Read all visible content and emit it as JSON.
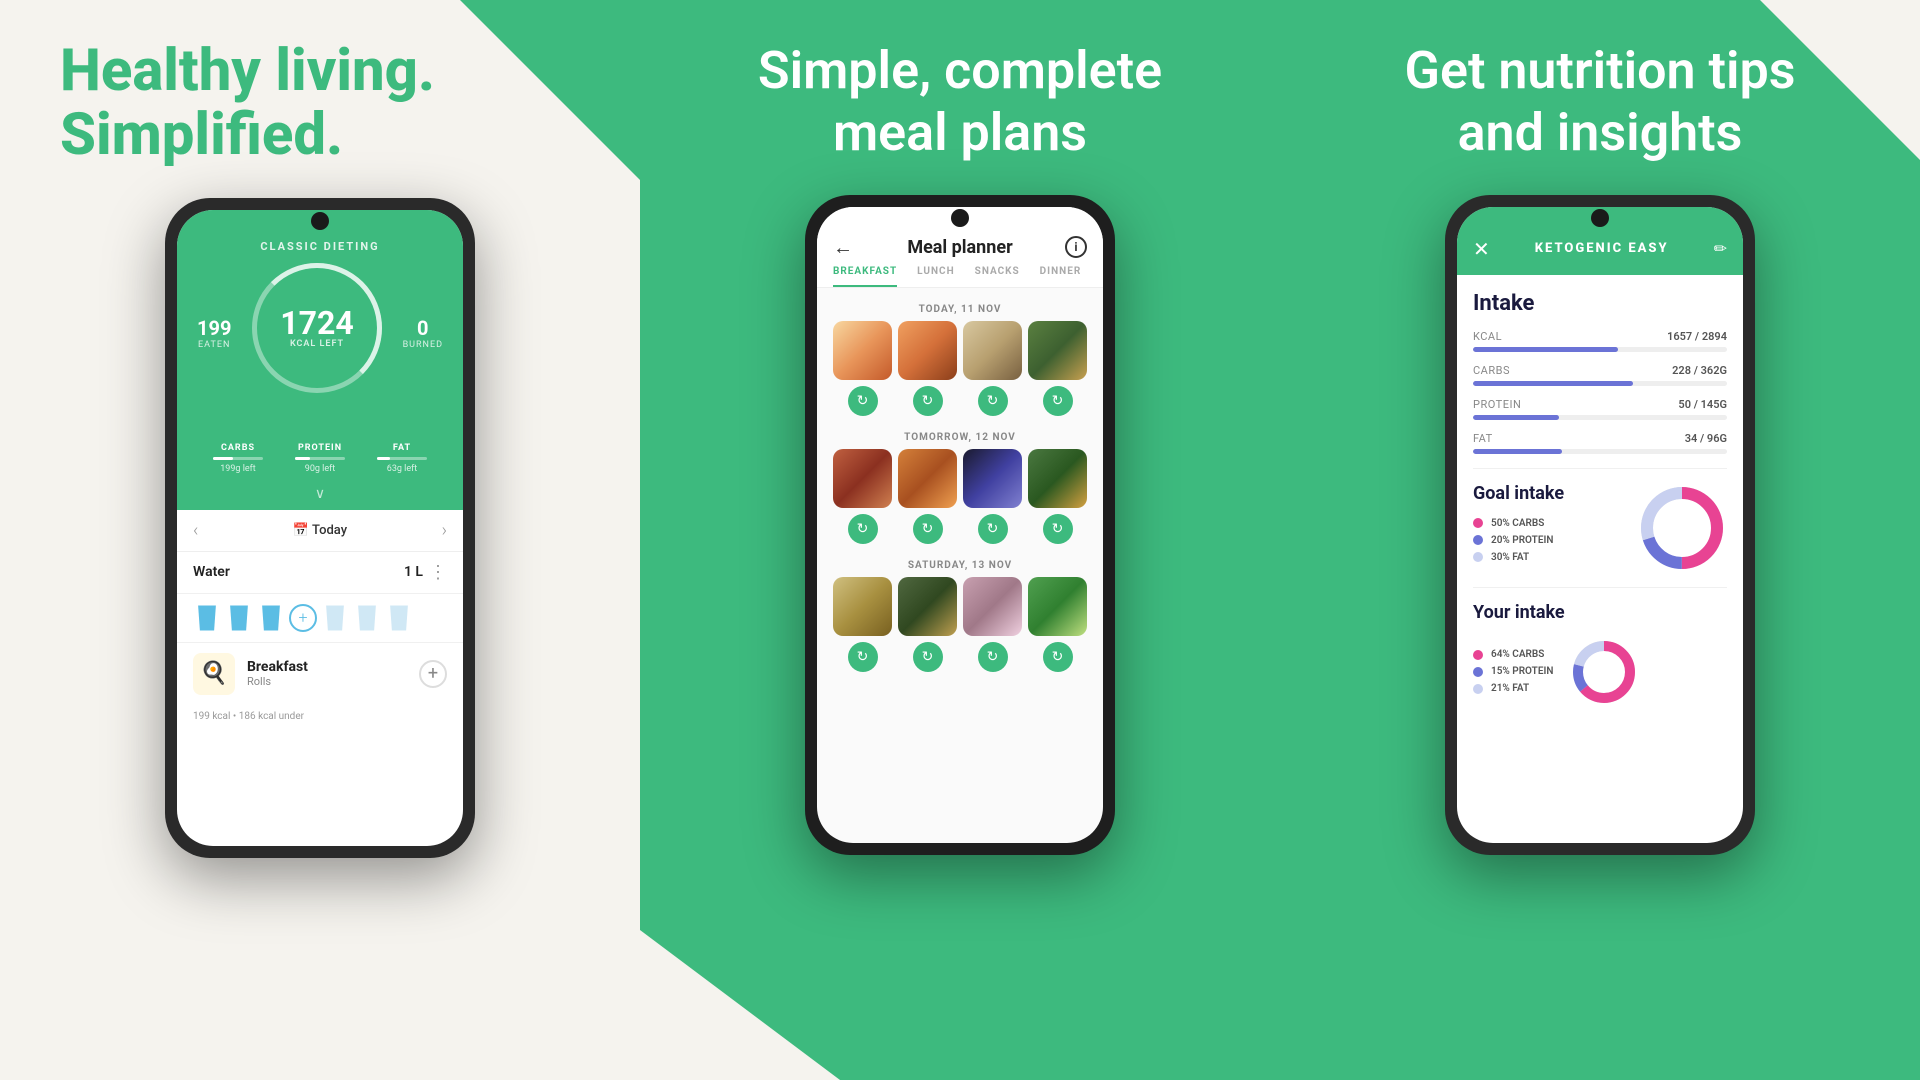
{
  "panel1": {
    "heading_line1": "Healthy living.",
    "heading_line2": "Simplified.",
    "phone": {
      "diet_label": "CLASSIC DIETING",
      "eaten": "199",
      "eaten_label": "EATEN",
      "kcal_left": "1724",
      "kcal_left_label": "KCAL LEFT",
      "burned": "0",
      "burned_label": "BURNED",
      "macros": [
        {
          "name": "CARBS",
          "left": "199g left",
          "fill": 40
        },
        {
          "name": "PROTEIN",
          "left": "90g left",
          "fill": 30
        },
        {
          "name": "FAT",
          "left": "63g left",
          "fill": 25
        }
      ],
      "nav_date": "Today",
      "water_title": "Water",
      "water_amount": "1 L",
      "meal_name": "Breakfast",
      "meal_sub": "Rolls",
      "meal_kcal": "199 kcal • 186 kcal under"
    }
  },
  "panel2": {
    "heading": "Simple, complete meal plans",
    "phone": {
      "title": "Meal planner",
      "tabs": [
        "BREAKFAST",
        "LUNCH",
        "SNACKS",
        "DINNER"
      ],
      "active_tab": "BREAKFAST",
      "days": [
        {
          "label": "TODAY, 11 NOV",
          "meals": [
            "food-1",
            "food-2",
            "food-3",
            "food-4"
          ]
        },
        {
          "label": "TOMORROW, 12 NOV",
          "meals": [
            "food-5",
            "food-6",
            "food-7",
            "food-8"
          ]
        },
        {
          "label": "SATURDAY, 13 NOV",
          "meals": [
            "food-9",
            "food-10",
            "food-11",
            "food-12"
          ]
        }
      ]
    }
  },
  "panel3": {
    "heading_line1": "Get nutrition tips",
    "heading_line2": "and insights",
    "phone": {
      "diet_label": "KETOGENIC EASY",
      "intake_title": "Intake",
      "nutrients": [
        {
          "name": "KCAL",
          "value": "1657 / 2894",
          "fill_pct": 57
        },
        {
          "name": "CARBS",
          "value": "228 / 362G",
          "fill_pct": 63
        },
        {
          "name": "PROTEIN",
          "value": "50 / 145G",
          "fill_pct": 34
        },
        {
          "name": "FAT",
          "value": "34 / 96G",
          "fill_pct": 35
        }
      ],
      "goal_title": "Goal intake",
      "goal_legend": [
        {
          "color": "#e84393",
          "label": "50% CARBS"
        },
        {
          "color": "#6b73d6",
          "label": "20% PROTEIN"
        },
        {
          "color": "#c8d0f0",
          "label": "30% FAT"
        }
      ],
      "your_intake_title": "Your intake",
      "your_intake_legend": [
        {
          "color": "#e84393",
          "label": "64% CARBS"
        },
        {
          "color": "#6b73d6",
          "label": "15% PROTEIN"
        },
        {
          "color": "#c8d0f0",
          "label": "21% FAT"
        }
      ]
    }
  }
}
